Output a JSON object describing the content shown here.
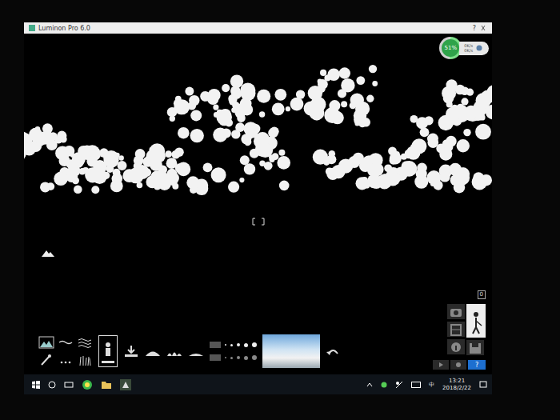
{
  "window": {
    "title": "Luminon Pro 6.0",
    "help": "?"
  },
  "badge": {
    "percent": "51%",
    "level": 0.51,
    "up": "0K/s",
    "down": "0K/s"
  },
  "tool_grid": [
    {
      "kind": "landscape",
      "selected": false
    },
    {
      "kind": "wave",
      "selected": false
    },
    {
      "kind": "water",
      "selected": false
    },
    {
      "kind": "brush",
      "selected": false
    },
    {
      "kind": "dots",
      "selected": false
    },
    {
      "kind": "grass",
      "selected": false
    }
  ],
  "tools": [
    {
      "kind": "figure",
      "selected": true
    },
    {
      "kind": "download",
      "selected": false
    },
    {
      "kind": "hill",
      "selected": false
    },
    {
      "kind": "bumps",
      "selected": false
    },
    {
      "kind": "mound",
      "selected": false
    }
  ],
  "right_panel": {
    "counter": "0",
    "help": "?",
    "buttons": [
      {
        "kind": "camera",
        "selected": false
      },
      {
        "kind": "film",
        "selected": false
      },
      {
        "kind": "info",
        "selected": false
      },
      {
        "kind": "figure",
        "selected": true
      },
      {
        "kind": "save",
        "selected": false
      }
    ]
  },
  "taskbar": {
    "ime": "中",
    "time": "13:21",
    "date": "2018/2/22"
  }
}
